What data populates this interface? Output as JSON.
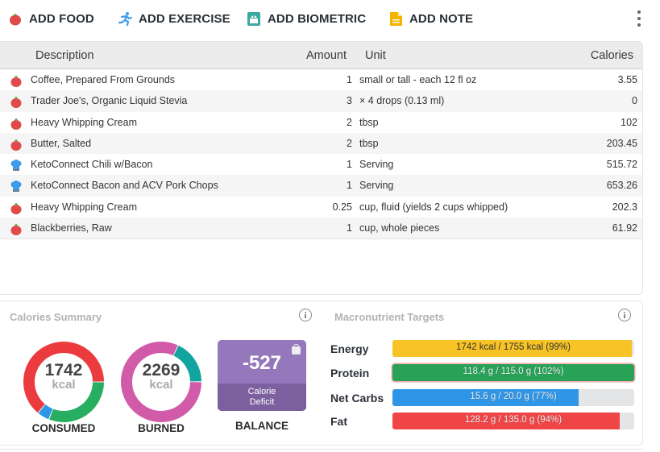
{
  "toolbar": {
    "buttons": [
      {
        "label": "ADD FOOD",
        "icon": "apple-icon",
        "color": "#e04a4a"
      },
      {
        "label": "ADD EXERCISE",
        "icon": "running-person-icon",
        "color": "#3e9be8"
      },
      {
        "label": "ADD BIOMETRIC",
        "icon": "scale-weight-icon",
        "color": "#3aa99f"
      },
      {
        "label": "ADD NOTE",
        "icon": "note-icon",
        "color": "#f4b400"
      }
    ],
    "more_icon": "kebab-menu-icon"
  },
  "diary": {
    "columns": {
      "description": "Description",
      "amount": "Amount",
      "unit": "Unit",
      "calories": "Calories"
    },
    "rows": [
      {
        "icon": "apple-icon",
        "description": "Coffee, Prepared From Grounds",
        "amount": "1",
        "unit": "small or tall - each 12 fl oz",
        "calories": "3.55"
      },
      {
        "icon": "apple-icon",
        "description": "Trader Joe's, Organic Liquid Stevia",
        "amount": "3",
        "unit": "× 4 drops (0.13 ml)",
        "calories": "0"
      },
      {
        "icon": "apple-icon",
        "description": "Heavy Whipping Cream",
        "amount": "2",
        "unit": "tbsp",
        "calories": "102"
      },
      {
        "icon": "apple-icon",
        "description": "Butter, Salted",
        "amount": "2",
        "unit": "tbsp",
        "calories": "203.45"
      },
      {
        "icon": "chef-hat-icon",
        "description": "KetoConnect Chili w/Bacon",
        "amount": "1",
        "unit": "Serving",
        "calories": "515.72"
      },
      {
        "icon": "chef-hat-icon",
        "description": "KetoConnect Bacon and ACV Pork Chops",
        "amount": "1",
        "unit": "Serving",
        "calories": "653.26"
      },
      {
        "icon": "apple-icon",
        "description": "Heavy Whipping Cream",
        "amount": "0.25",
        "unit": "cup, fluid (yields 2 cups whipped)",
        "calories": "202.3"
      },
      {
        "icon": "apple-icon",
        "description": "Blackberries, Raw",
        "amount": "1",
        "unit": "cup, whole pieces",
        "calories": "61.92"
      }
    ]
  },
  "calories_summary": {
    "title": "Calories Summary",
    "consumed": {
      "value": "1742",
      "unit": "kcal",
      "label": "CONSUMED",
      "segments": [
        {
          "name": "fat",
          "fraction": 0.64,
          "color": "#ec3b3f"
        },
        {
          "name": "protein",
          "fraction": 0.31,
          "color": "#27ae60"
        },
        {
          "name": "carbs",
          "fraction": 0.05,
          "color": "#2f95e6"
        }
      ]
    },
    "burned": {
      "value": "2269",
      "unit": "kcal",
      "label": "BURNED",
      "segments": [
        {
          "name": "bmr",
          "fraction": 0.82,
          "color": "#d25ba9"
        },
        {
          "name": "exercise",
          "fraction": 0.18,
          "color": "#12a5a0"
        }
      ]
    },
    "balance": {
      "value": "-527",
      "sub": [
        "Calorie",
        "Deficit"
      ],
      "label": "BALANCE",
      "color": "#9478bb",
      "sub_color": "#7b5f9f"
    }
  },
  "macro_targets": {
    "title": "Macronutrient Targets",
    "rows": [
      {
        "label": "Energy",
        "text": "1742 kcal / 1755 kcal (99%)",
        "percent": 99,
        "color": "#f7c325",
        "light_text": false,
        "over": false
      },
      {
        "label": "Protein",
        "text": "118.4 g / 115.0 g (102%)",
        "percent": 102,
        "color": "#27a257",
        "light_text": true,
        "over": true
      },
      {
        "label": "Net Carbs",
        "text": "15.6 g / 20.0 g (77%)",
        "percent": 77,
        "color": "#2f95e6",
        "light_text": true,
        "over": false
      },
      {
        "label": "Fat",
        "text": "128.2 g / 135.0 g (94%)",
        "percent": 94,
        "color": "#ef4547",
        "light_text": true,
        "over": false
      }
    ]
  }
}
